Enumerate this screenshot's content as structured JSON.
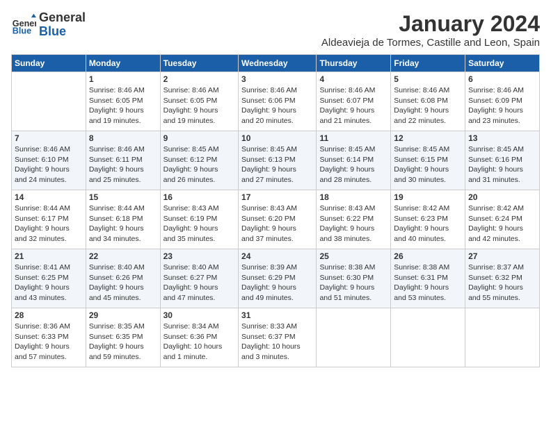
{
  "logo": {
    "general": "General",
    "blue": "Blue"
  },
  "title": "January 2024",
  "subtitle": "Aldeavieja de Tormes, Castille and Leon, Spain",
  "days_of_week": [
    "Sunday",
    "Monday",
    "Tuesday",
    "Wednesday",
    "Thursday",
    "Friday",
    "Saturday"
  ],
  "weeks": [
    [
      {
        "day": "",
        "info": ""
      },
      {
        "day": "1",
        "info": "Sunrise: 8:46 AM\nSunset: 6:05 PM\nDaylight: 9 hours\nand 19 minutes."
      },
      {
        "day": "2",
        "info": "Sunrise: 8:46 AM\nSunset: 6:05 PM\nDaylight: 9 hours\nand 19 minutes."
      },
      {
        "day": "3",
        "info": "Sunrise: 8:46 AM\nSunset: 6:06 PM\nDaylight: 9 hours\nand 20 minutes."
      },
      {
        "day": "4",
        "info": "Sunrise: 8:46 AM\nSunset: 6:07 PM\nDaylight: 9 hours\nand 21 minutes."
      },
      {
        "day": "5",
        "info": "Sunrise: 8:46 AM\nSunset: 6:08 PM\nDaylight: 9 hours\nand 22 minutes."
      },
      {
        "day": "6",
        "info": "Sunrise: 8:46 AM\nSunset: 6:09 PM\nDaylight: 9 hours\nand 23 minutes."
      }
    ],
    [
      {
        "day": "7",
        "info": "Sunrise: 8:46 AM\nSunset: 6:10 PM\nDaylight: 9 hours\nand 24 minutes."
      },
      {
        "day": "8",
        "info": "Sunrise: 8:46 AM\nSunset: 6:11 PM\nDaylight: 9 hours\nand 25 minutes."
      },
      {
        "day": "9",
        "info": "Sunrise: 8:45 AM\nSunset: 6:12 PM\nDaylight: 9 hours\nand 26 minutes."
      },
      {
        "day": "10",
        "info": "Sunrise: 8:45 AM\nSunset: 6:13 PM\nDaylight: 9 hours\nand 27 minutes."
      },
      {
        "day": "11",
        "info": "Sunrise: 8:45 AM\nSunset: 6:14 PM\nDaylight: 9 hours\nand 28 minutes."
      },
      {
        "day": "12",
        "info": "Sunrise: 8:45 AM\nSunset: 6:15 PM\nDaylight: 9 hours\nand 30 minutes."
      },
      {
        "day": "13",
        "info": "Sunrise: 8:45 AM\nSunset: 6:16 PM\nDaylight: 9 hours\nand 31 minutes."
      }
    ],
    [
      {
        "day": "14",
        "info": "Sunrise: 8:44 AM\nSunset: 6:17 PM\nDaylight: 9 hours\nand 32 minutes."
      },
      {
        "day": "15",
        "info": "Sunrise: 8:44 AM\nSunset: 6:18 PM\nDaylight: 9 hours\nand 34 minutes."
      },
      {
        "day": "16",
        "info": "Sunrise: 8:43 AM\nSunset: 6:19 PM\nDaylight: 9 hours\nand 35 minutes."
      },
      {
        "day": "17",
        "info": "Sunrise: 8:43 AM\nSunset: 6:20 PM\nDaylight: 9 hours\nand 37 minutes."
      },
      {
        "day": "18",
        "info": "Sunrise: 8:43 AM\nSunset: 6:22 PM\nDaylight: 9 hours\nand 38 minutes."
      },
      {
        "day": "19",
        "info": "Sunrise: 8:42 AM\nSunset: 6:23 PM\nDaylight: 9 hours\nand 40 minutes."
      },
      {
        "day": "20",
        "info": "Sunrise: 8:42 AM\nSunset: 6:24 PM\nDaylight: 9 hours\nand 42 minutes."
      }
    ],
    [
      {
        "day": "21",
        "info": "Sunrise: 8:41 AM\nSunset: 6:25 PM\nDaylight: 9 hours\nand 43 minutes."
      },
      {
        "day": "22",
        "info": "Sunrise: 8:40 AM\nSunset: 6:26 PM\nDaylight: 9 hours\nand 45 minutes."
      },
      {
        "day": "23",
        "info": "Sunrise: 8:40 AM\nSunset: 6:27 PM\nDaylight: 9 hours\nand 47 minutes."
      },
      {
        "day": "24",
        "info": "Sunrise: 8:39 AM\nSunset: 6:29 PM\nDaylight: 9 hours\nand 49 minutes."
      },
      {
        "day": "25",
        "info": "Sunrise: 8:38 AM\nSunset: 6:30 PM\nDaylight: 9 hours\nand 51 minutes."
      },
      {
        "day": "26",
        "info": "Sunrise: 8:38 AM\nSunset: 6:31 PM\nDaylight: 9 hours\nand 53 minutes."
      },
      {
        "day": "27",
        "info": "Sunrise: 8:37 AM\nSunset: 6:32 PM\nDaylight: 9 hours\nand 55 minutes."
      }
    ],
    [
      {
        "day": "28",
        "info": "Sunrise: 8:36 AM\nSunset: 6:33 PM\nDaylight: 9 hours\nand 57 minutes."
      },
      {
        "day": "29",
        "info": "Sunrise: 8:35 AM\nSunset: 6:35 PM\nDaylight: 9 hours\nand 59 minutes."
      },
      {
        "day": "30",
        "info": "Sunrise: 8:34 AM\nSunset: 6:36 PM\nDaylight: 10 hours\nand 1 minute."
      },
      {
        "day": "31",
        "info": "Sunrise: 8:33 AM\nSunset: 6:37 PM\nDaylight: 10 hours\nand 3 minutes."
      },
      {
        "day": "",
        "info": ""
      },
      {
        "day": "",
        "info": ""
      },
      {
        "day": "",
        "info": ""
      }
    ]
  ]
}
